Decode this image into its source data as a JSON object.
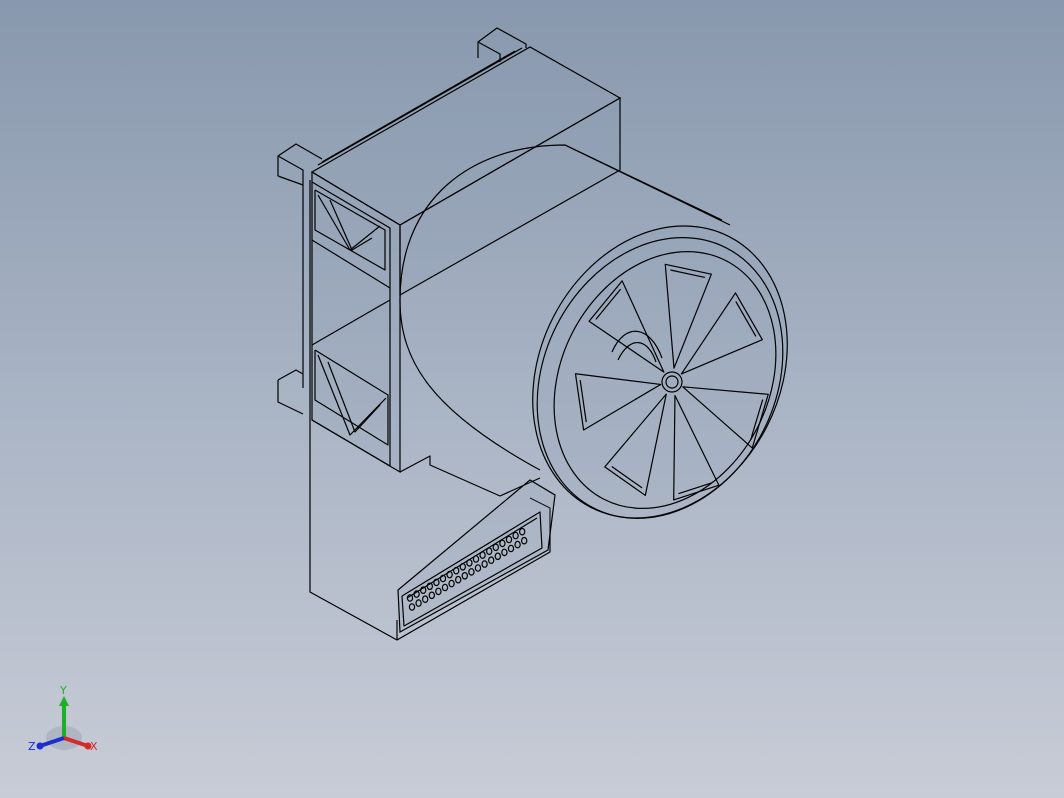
{
  "viewport": {
    "background_top": "#8898ad",
    "background_bottom": "#c8ccd6",
    "edge_color": "#000000"
  },
  "model": {
    "description_icon": "fan-assembly-wireframe"
  },
  "triad": {
    "x_label": "X",
    "y_label": "Y",
    "z_label": "Z",
    "x_color": "#d42a2a",
    "y_color": "#1fae2a",
    "z_color": "#1b2fd1"
  }
}
